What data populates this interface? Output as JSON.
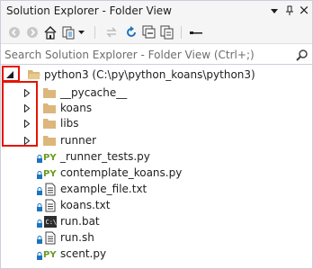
{
  "window": {
    "title": "Solution Explorer - Folder View"
  },
  "toolbar": {
    "icons": [
      "back-icon",
      "forward-icon",
      "home-icon",
      "switch-views-icon",
      "dropdown-icon",
      "sync-icon",
      "refresh-icon",
      "collapse-all-icon",
      "show-all-files-icon",
      "properties-icon"
    ]
  },
  "search": {
    "placeholder": "Search Solution Explorer - Folder View (Ctrl+;)"
  },
  "tree": {
    "root": {
      "label": "python3 (C:\\py\\python_koans\\python3)",
      "expanded": true
    },
    "folders": [
      {
        "label": "__pycache__"
      },
      {
        "label": "koans"
      },
      {
        "label": "libs"
      },
      {
        "label": "runner"
      }
    ],
    "files": [
      {
        "label": "_runner_tests.py",
        "type": "python"
      },
      {
        "label": "contemplate_koans.py",
        "type": "python"
      },
      {
        "label": "example_file.txt",
        "type": "text"
      },
      {
        "label": "koans.txt",
        "type": "text"
      },
      {
        "label": "run.bat",
        "type": "batch"
      },
      {
        "label": "run.sh",
        "type": "text"
      },
      {
        "label": "scent.py",
        "type": "python"
      }
    ]
  },
  "colors": {
    "highlight_border": "#e51400",
    "folder": "#dcb67a",
    "python_icon": "#6a9a23",
    "lock": "#1e73be",
    "accent": "#1e73be"
  }
}
